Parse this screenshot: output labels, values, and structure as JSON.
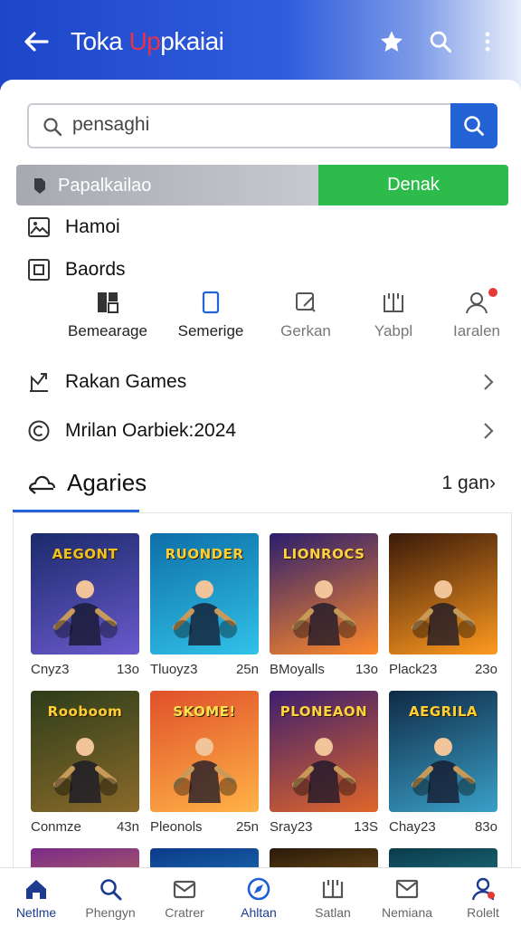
{
  "appbar": {
    "title_a": "Toka ",
    "title_b": "Up",
    "title_c": "pkaiai",
    "back_icon": "arrow-left-icon",
    "actions": [
      "star-icon",
      "search-icon",
      "more-vert-icon"
    ]
  },
  "search": {
    "value": "pensaghi",
    "button_icon": "search-icon"
  },
  "filter": {
    "left_label": "Papalkailao",
    "right_label": "Denak"
  },
  "rows": {
    "hamoi": "Hamoi",
    "baords": "Baords",
    "games": "Rakan Games",
    "mrilan": "Mrilan Oarbiek:2024"
  },
  "categories": [
    {
      "label": "Bemearage",
      "icon": "grid-icon"
    },
    {
      "label": "Semerige",
      "icon": "tablet-icon"
    },
    {
      "label": "Gerkan",
      "icon": "edit-icon"
    },
    {
      "label": "Yabpl",
      "icon": "book-icon"
    },
    {
      "label": "Iaralen",
      "icon": "person-icon"
    }
  ],
  "section": {
    "title": "Agaries",
    "more": "1 gan›"
  },
  "games": [
    {
      "name": "Cnyz3",
      "count": "13o",
      "title": "AEGONT",
      "bg": [
        "#1b2a6b",
        "#6a5acd"
      ],
      "fg": "#f2c21b"
    },
    {
      "name": "Tluoyz3",
      "count": "25n",
      "title": "RUONDER",
      "bg": [
        "#0e6fa8",
        "#31c2e8"
      ],
      "fg": "#ffcf33"
    },
    {
      "name": "BMoyalls",
      "count": "13o",
      "title": "LIONROCS",
      "bg": [
        "#2b1e6e",
        "#ff8a2a"
      ],
      "fg": "#ffd23f"
    },
    {
      "name": "Plack23",
      "count": "23o",
      "title": "",
      "bg": [
        "#3a1a0a",
        "#ff9a1f"
      ],
      "fg": "#ffd23f"
    },
    {
      "name": "Conmze",
      "count": "43n",
      "title": "Rooboom",
      "bg": [
        "#2d3d1a",
        "#8a6a2a"
      ],
      "fg": "#ffcf33"
    },
    {
      "name": "Pleonols",
      "count": "25n",
      "title": "SKOME!",
      "bg": [
        "#e0502a",
        "#ffb347"
      ],
      "fg": "#ffe14d"
    },
    {
      "name": "Sray23",
      "count": "13S",
      "title": "PLONEAON",
      "bg": [
        "#3d1f6e",
        "#e0662a"
      ],
      "fg": "#ffd23f"
    },
    {
      "name": "Chay23",
      "count": "83o",
      "title": "AEGRILA",
      "bg": [
        "#0f2a45",
        "#3aa0c8"
      ],
      "fg": "#ffcf33"
    }
  ],
  "bottom_nav": [
    {
      "label": "Netlme",
      "icon": "home-icon",
      "active": true
    },
    {
      "label": "Phengyn",
      "icon": "search-icon"
    },
    {
      "label": "Cratrer",
      "icon": "mail-icon"
    },
    {
      "label": "Ahltan",
      "icon": "compass-icon",
      "active": true
    },
    {
      "label": "Satlan",
      "icon": "book-icon"
    },
    {
      "label": "Nemiana",
      "icon": "inbox-icon"
    },
    {
      "label": "Rolelt",
      "icon": "person-icon"
    }
  ],
  "colors": {
    "appbar": "#1d46c9",
    "accent": "#2363d6",
    "green": "#2dbb4b"
  }
}
